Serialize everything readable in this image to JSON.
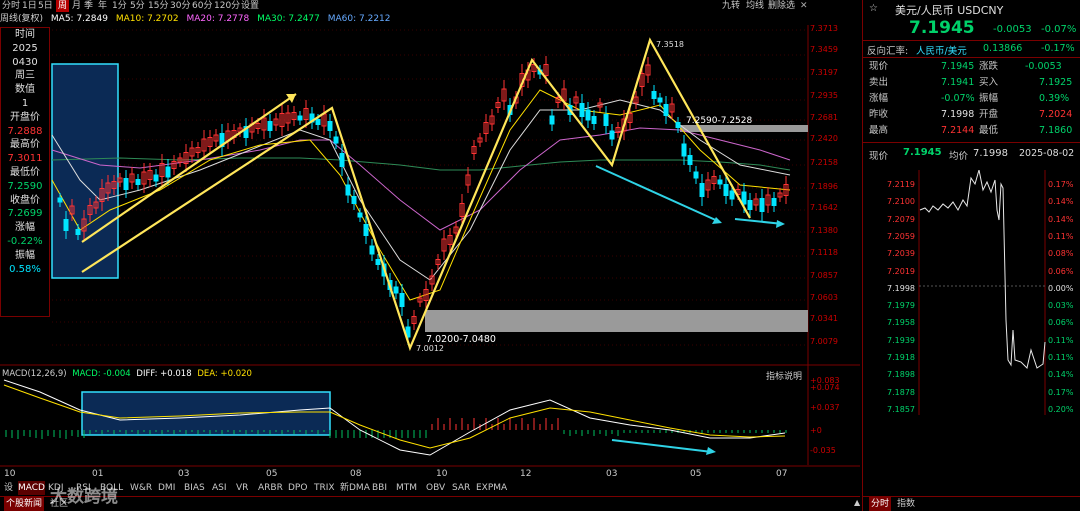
{
  "topbar": {
    "periods": [
      "分时",
      "1日",
      "5日",
      "周",
      "月",
      "季",
      "年",
      "1分",
      "5分",
      "15分",
      "30分",
      "60分",
      "120分",
      "设置"
    ],
    "selected": "周",
    "tools": [
      "九转",
      "均线",
      "删除选"
    ]
  },
  "legend": {
    "name": "周线(复权)",
    "ma5": "MA5: 7.2849",
    "ma10": "MA10: 7.2702",
    "ma20": "MA20: 7.2778",
    "ma30": "MA30: 7.2477",
    "ma60": "MA60: 7.2212"
  },
  "infobox": [
    {
      "t": "时间",
      "c": "white"
    },
    {
      "t": "2025",
      "c": "white"
    },
    {
      "t": "0430",
      "c": "white"
    },
    {
      "t": "周三",
      "c": "white"
    },
    {
      "t": "数值",
      "c": "white"
    },
    {
      "t": "1",
      "c": "white"
    },
    {
      "t": "开盘价",
      "c": "white"
    },
    {
      "t": "7.2888",
      "c": "red"
    },
    {
      "t": "最高价",
      "c": "white"
    },
    {
      "t": "7.3011",
      "c": "red"
    },
    {
      "t": "最低价",
      "c": "white"
    },
    {
      "t": "7.2590",
      "c": "green"
    },
    {
      "t": "收盘价",
      "c": "white"
    },
    {
      "t": "7.2699",
      "c": "green"
    },
    {
      "t": "涨幅",
      "c": "white"
    },
    {
      "t": "-0.22%",
      "c": "green"
    },
    {
      "t": "振幅",
      "c": "white"
    },
    {
      "t": "0.58%",
      "c": "cyan"
    }
  ],
  "yaxis": [
    "7.3713",
    "7.3459",
    "7.3197",
    "7.2935",
    "7.2681",
    "7.2420",
    "7.2158",
    "7.1896",
    "7.1642",
    "7.1380",
    "7.1118",
    "7.0857",
    "7.0603",
    "7.0341",
    "7.0079"
  ],
  "annotations": {
    "high": "7.3518",
    "low": "7.0012",
    "zone_top": "7.2590-7.2528",
    "zone_bottom": "7.0200-7.0480"
  },
  "macd": {
    "legend": "MACD(12,26,9)",
    "macd": "MACD: -0.004",
    "diff": "DIFF: +0.018",
    "dea": "DEA: +0.020",
    "help": "指标说明",
    "yaxis": [
      "+0.083",
      "+0.074",
      "+0.037",
      "+0",
      "-0.035"
    ]
  },
  "xaxis": [
    "10",
    "01",
    "03",
    "05",
    "08",
    "10",
    "12",
    "03",
    "05",
    "07"
  ],
  "indicators": [
    "设",
    "MACD",
    "KDJ",
    "RSI",
    "BOLL",
    "W&R",
    "DMI",
    "BIAS",
    "ASI",
    "VR",
    "ARBR",
    "DPO",
    "TRIX",
    "新DMA",
    "BBI",
    "MTM",
    "OBV",
    "SAR",
    "EXPMA"
  ],
  "bottom_tabs": [
    "个股新闻",
    "社区"
  ],
  "watermark": "大数跨境",
  "quote": {
    "title": "美元/人民币 USDCNY",
    "price": "7.1945",
    "change": "-0.0053",
    "pct": "-0.07%",
    "reverse_label": "反向汇率:",
    "reverse_pair": "人民币/美元",
    "reverse_value": "0.13866",
    "reverse_pct": "-0.17%",
    "rows": [
      {
        "l1": "现价",
        "v1": "7.1945",
        "c1": "green",
        "l2": "涨跌",
        "v2": "-0.0053",
        "c2": "green"
      },
      {
        "l1": "卖出",
        "v1": "7.1941",
        "c1": "green",
        "l2": "买入",
        "v2": "7.1925",
        "c2": "green"
      },
      {
        "l1": "涨幅",
        "v1": "-0.07%",
        "c1": "green",
        "l2": "振幅",
        "v2": "0.39%",
        "c2": "green"
      },
      {
        "l1": "昨收",
        "v1": "7.1998",
        "c1": "white",
        "l2": "开盘",
        "v2": "7.2024",
        "c2": "red"
      },
      {
        "l1": "最高",
        "v1": "7.2144",
        "c1": "red",
        "l2": "最低",
        "v2": "7.1860",
        "c2": "green"
      }
    ],
    "intraday": {
      "label_now": "现价",
      "now": "7.1945",
      "label_avg": "均价",
      "avg": "7.1998",
      "date": "2025-08-02"
    },
    "mini_left": [
      "7.2119",
      "7.2100",
      "7.2079",
      "7.2059",
      "7.2039",
      "7.2019",
      "7.1998",
      "7.1979",
      "7.1958",
      "7.1939",
      "7.1918",
      "7.1898",
      "7.1878",
      "7.1857"
    ],
    "mini_right": [
      "0.17%",
      "0.14%",
      "0.14%",
      "0.11%",
      "0.08%",
      "0.06%",
      "0.00%",
      "0.03%",
      "0.06%",
      "0.11%",
      "0.11%",
      "0.14%",
      "0.17%",
      "0.20%"
    ],
    "tabs": [
      "分时",
      "指数"
    ]
  },
  "colors": {
    "up": "#ff3333",
    "down": "#00e5ff",
    "bg": "#000000",
    "border": "#7a0000",
    "annot_yellow": "#ffe65a",
    "annot_cyan": "#2fd3e6"
  }
}
